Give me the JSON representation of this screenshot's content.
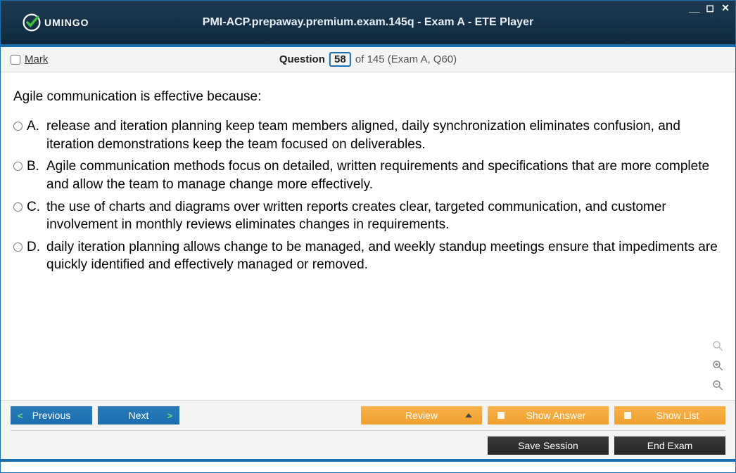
{
  "brand": {
    "name": "UMINGO"
  },
  "window": {
    "title": "PMI-ACP.prepaway.premium.exam.145q - Exam A - ETE Player"
  },
  "infobar": {
    "mark_label": "Mark",
    "question_label": "Question",
    "current": "58",
    "total_suffix": "of 145 (Exam A, Q60)"
  },
  "question": {
    "text": "Agile communication is effective because:",
    "options": [
      {
        "letter": "A.",
        "text": "release and iteration planning keep team members aligned, daily synchronization eliminates confusion, and iteration demonstrations keep the team focused on deliverables."
      },
      {
        "letter": "B.",
        "text": "Agile communication methods focus on detailed, written requirements and specifications that are more complete and allow the team to manage change more effectively."
      },
      {
        "letter": "C.",
        "text": "the use of charts and diagrams over written reports creates clear, targeted communication, and customer involvement in monthly reviews eliminates changes in requirements."
      },
      {
        "letter": "D.",
        "text": "daily iteration planning allows change to be managed, and weekly standup meetings ensure that impediments are quickly identified and effectively managed or removed."
      }
    ]
  },
  "footer": {
    "previous": "Previous",
    "next": "Next",
    "review": "Review",
    "show_answer": "Show Answer",
    "show_list": "Show List",
    "save_session": "Save Session",
    "end_exam": "End Exam"
  }
}
